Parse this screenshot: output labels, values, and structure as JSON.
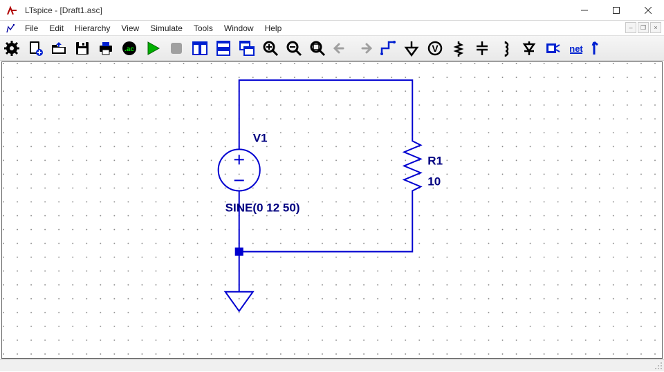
{
  "window": {
    "title": "LTspice - [Draft1.asc]"
  },
  "menu": {
    "file": "File",
    "edit": "Edit",
    "hierarchy": "Hierarchy",
    "view": "View",
    "simulate": "Simulate",
    "tools": "Tools",
    "window": "Window",
    "help": "Help"
  },
  "toolbar": {
    "items": [
      "settings-gear",
      "new-schematic",
      "open-file",
      "save-file",
      "print",
      "op-point",
      "run-simulation",
      "stop-simulation",
      "tile-vertical",
      "tile-horizontal",
      "cascade-windows",
      "zoom-in",
      "zoom-out",
      "zoom-fit",
      "undo",
      "redo",
      "wire",
      "ground",
      "voltage-source",
      "resistor",
      "capacitor",
      "inductor",
      "diode",
      "component",
      "net-label",
      "move"
    ]
  },
  "circuit": {
    "source": {
      "name": "V1",
      "value": "SINE(0 12 50)"
    },
    "resistor": {
      "name": "R1",
      "value": "10"
    }
  },
  "colors": {
    "schematic_blue": "#0000d0",
    "schematic_node": "#0000d0",
    "text_label": "#000080",
    "grid_dot": "#808080"
  }
}
